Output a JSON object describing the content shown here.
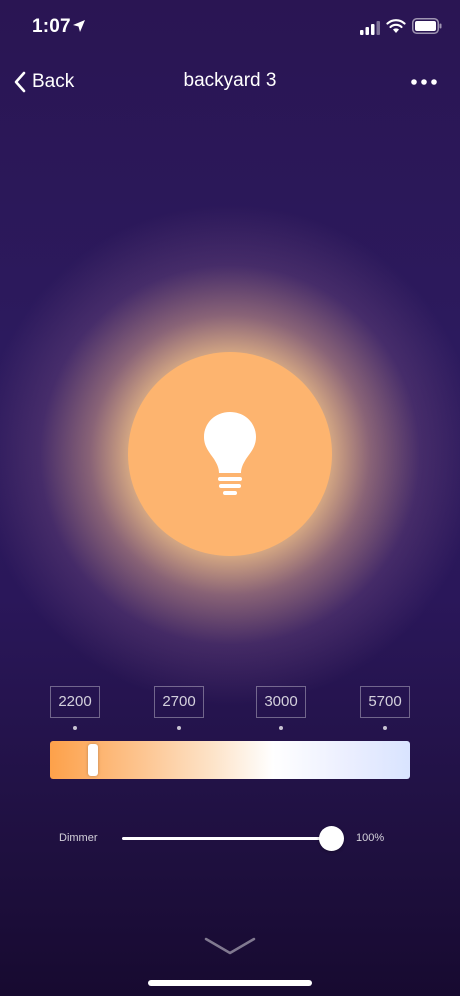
{
  "status_bar": {
    "time": "1:07"
  },
  "nav": {
    "back_label": "Back",
    "title": "backyard 3"
  },
  "color_temperature": {
    "presets": [
      "2200",
      "2700",
      "3000",
      "5700"
    ],
    "current_fraction": 0.12
  },
  "dimmer": {
    "label": "Dimmer",
    "value": "100%",
    "level_percent": 100
  },
  "colors": {
    "background": "#271651",
    "bulb": "#fdb46f",
    "accent": "#ffffff"
  }
}
